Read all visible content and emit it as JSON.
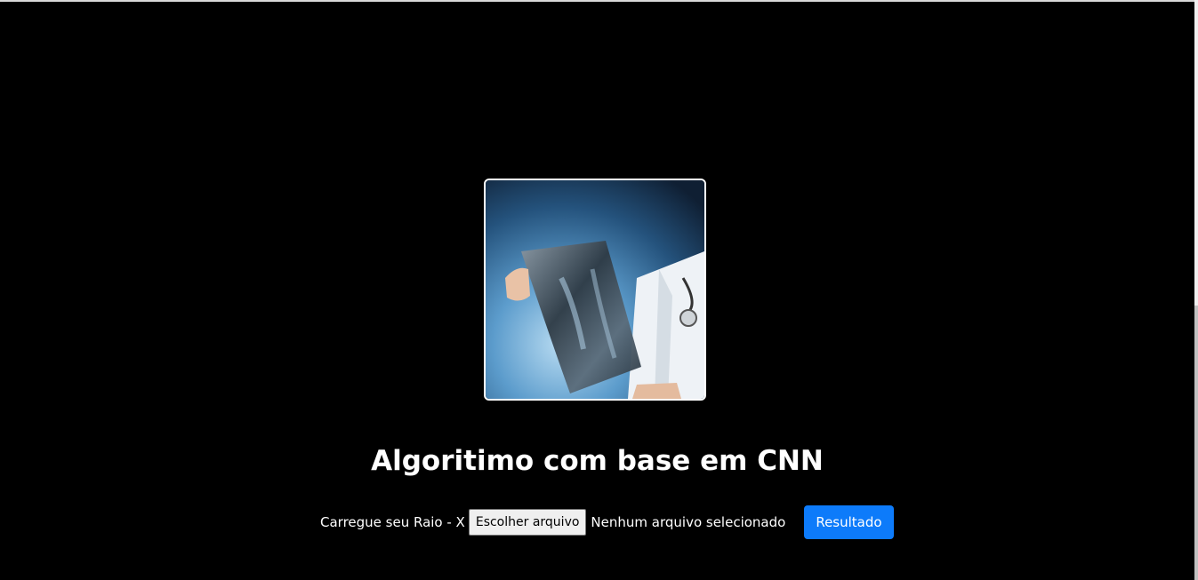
{
  "hero": {
    "image_description_icon": "doctor-xray-photo",
    "background_color": "#000000"
  },
  "title": "Algoritimo com base em CNN",
  "upload": {
    "label": "Carregue seu Raio - X",
    "choose_file_button": "Escolher arquivo",
    "file_status": "Nenhum arquivo selecionado",
    "submit_button": "Resultado",
    "submit_color": "#0d7bfa"
  }
}
